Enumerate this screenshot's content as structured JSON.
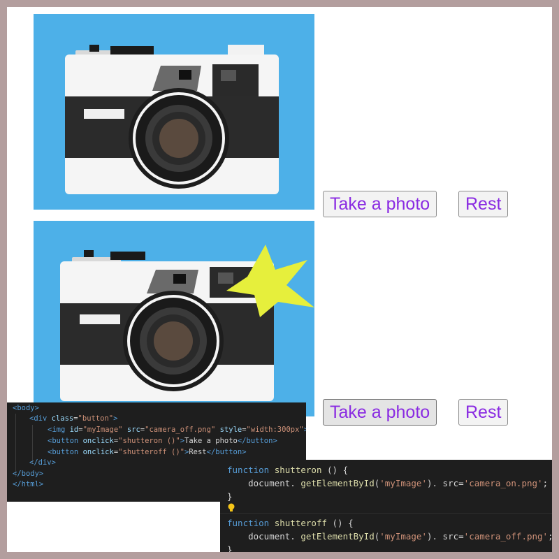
{
  "buttons": {
    "take_photo_label": "Take a photo",
    "rest_label": "Rest"
  },
  "html_code": {
    "lines": [
      {
        "parts": [
          [
            "tag",
            "<body>"
          ]
        ]
      },
      {
        "parts": [
          [
            "tag",
            "<div "
          ],
          [
            "attr",
            "class"
          ],
          [
            "txt",
            "="
          ],
          [
            "str",
            "\"button\""
          ],
          [
            "tag",
            ">"
          ]
        ]
      },
      {
        "parts": [
          [
            "tag",
            "<img "
          ],
          [
            "attr",
            "id"
          ],
          [
            "txt",
            "="
          ],
          [
            "str",
            "\"myImage\""
          ],
          [
            "txt",
            " "
          ],
          [
            "attr",
            "src"
          ],
          [
            "txt",
            "="
          ],
          [
            "str",
            "\"camera_off.png\""
          ],
          [
            "txt",
            " "
          ],
          [
            "attr",
            "style"
          ],
          [
            "txt",
            "="
          ],
          [
            "str",
            "\"width:300px\""
          ],
          [
            "tag",
            ">"
          ]
        ]
      },
      {
        "parts": [
          [
            "tag",
            "<button "
          ],
          [
            "attr",
            "onclick"
          ],
          [
            "txt",
            "="
          ],
          [
            "str",
            "\"shutteron ()\""
          ],
          [
            "tag",
            ">"
          ],
          [
            "txt",
            "Take a photo"
          ],
          [
            "tag",
            "</button>"
          ]
        ]
      },
      {
        "parts": [
          [
            "tag",
            "<button "
          ],
          [
            "attr",
            "onclick"
          ],
          [
            "txt",
            "="
          ],
          [
            "str",
            "\"shutteroff ()\""
          ],
          [
            "tag",
            ">"
          ],
          [
            "txt",
            "Rest"
          ],
          [
            "tag",
            "</button>"
          ]
        ]
      },
      {
        "parts": [
          [
            "tag",
            "</div>"
          ]
        ]
      },
      {
        "parts": [
          [
            "tag",
            "</body>"
          ]
        ]
      },
      {
        "parts": [
          [
            "tag",
            "</html>"
          ]
        ]
      }
    ]
  },
  "js_code": {
    "lines": [
      {
        "parts": [
          [
            "kw",
            "function "
          ],
          [
            "fn",
            "shutteron"
          ],
          [
            "txt",
            " () {"
          ]
        ]
      },
      {
        "parts": [
          [
            "txt",
            "    document. "
          ],
          [
            "fn",
            "getElementById"
          ],
          [
            "txt",
            "("
          ],
          [
            "s2",
            "'myImage'"
          ],
          [
            "txt",
            "). src="
          ],
          [
            "s2",
            "'camera_on.png'"
          ],
          [
            "txt",
            ";"
          ]
        ]
      },
      {
        "parts": [
          [
            "txt",
            "}"
          ]
        ]
      },
      {
        "parts": []
      },
      {
        "parts": [
          [
            "kw",
            "function "
          ],
          [
            "fn",
            "shutteroff"
          ],
          [
            "txt",
            " () {"
          ]
        ]
      },
      {
        "parts": [
          [
            "txt",
            "    document. "
          ],
          [
            "fn",
            "getElementById"
          ],
          [
            "txt",
            "("
          ],
          [
            "s2",
            "'myImage'"
          ],
          [
            "txt",
            "). src="
          ],
          [
            "s2",
            "'camera_off.png'"
          ],
          [
            "txt",
            ";"
          ]
        ]
      },
      {
        "parts": [
          [
            "txt",
            "}"
          ]
        ]
      }
    ]
  },
  "colors": {
    "photo_bg": "#4db0e8",
    "button_text": "#8a2be2",
    "flash": "#e6ef3c",
    "code_bg": "#1e1e1e"
  },
  "icons": [
    "camera-off-image",
    "camera-on-image",
    "flash-star-icon",
    "lightbulb-icon"
  ]
}
